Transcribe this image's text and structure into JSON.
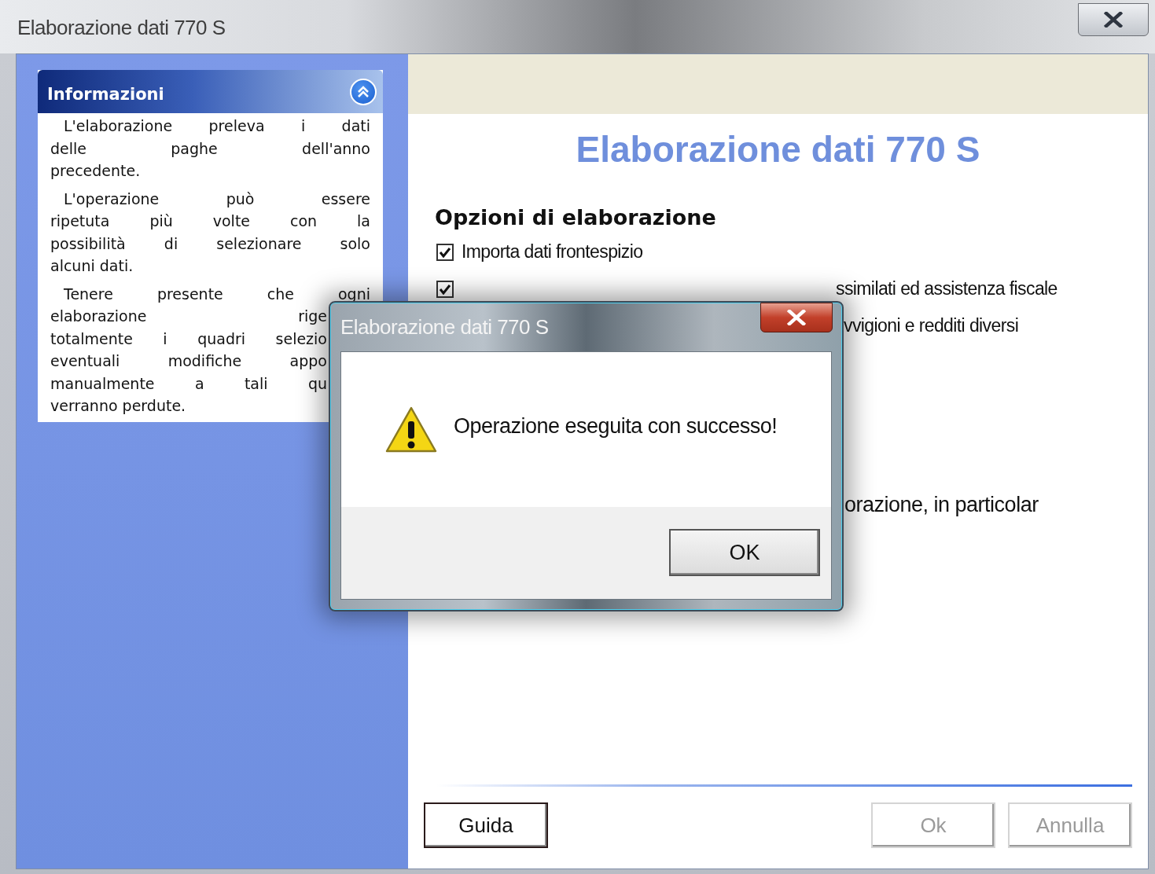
{
  "window": {
    "title": "Elaborazione dati 770 S"
  },
  "info_panel": {
    "title": "Informazioni",
    "expanded": true,
    "paragraphs": [
      {
        "lines": [
          {
            "text": "L'elaborazione preleva i dati",
            "cut": false
          },
          {
            "text": "delle paghe dell'anno",
            "cut": false
          },
          {
            "text": "precedente.",
            "cut": false
          }
        ]
      },
      {
        "lines": [
          {
            "text": "L'operazione può essere",
            "cut": false
          },
          {
            "text": "ripetuta più volte con la",
            "cut": false
          },
          {
            "text": "possibilità di selezionare solo",
            "cut": false
          },
          {
            "text": "alcuni dati.",
            "cut": false
          }
        ]
      },
      {
        "lines": [
          {
            "text": "Tenere presente che ogni",
            "cut": false
          },
          {
            "text": "elaborazione rige",
            "cut": true
          },
          {
            "text": "totalmente i quadri selezio",
            "cut": true
          },
          {
            "text": "eventuali modifiche appo",
            "cut": true
          },
          {
            "text": "manualmente a tali qu",
            "cut": true
          },
          {
            "text": "verranno perdute.",
            "cut": false
          }
        ]
      }
    ]
  },
  "heading": "Elaborazione dati 770 S",
  "options_title": "Opzioni di elaborazione",
  "options": [
    {
      "kind": "full",
      "label": "Importa dati frontespizio",
      "checked": true
    },
    {
      "kind": "covered",
      "label": "ssimilati ed assistenza fiscale",
      "checked": true
    },
    {
      "kind": "hidden",
      "label": "vvigioni e redditi diversi"
    }
  ],
  "note": "orazione, in particolar",
  "dialog": {
    "title": "Elaborazione dati 770 S",
    "message": "Operazione eseguita con successo!",
    "button": "OK"
  },
  "buttons": [
    {
      "label": "Guida",
      "disabled": false
    },
    {
      "label": "Ok",
      "disabled": true
    },
    {
      "label": "Annulla",
      "disabled": true
    }
  ]
}
